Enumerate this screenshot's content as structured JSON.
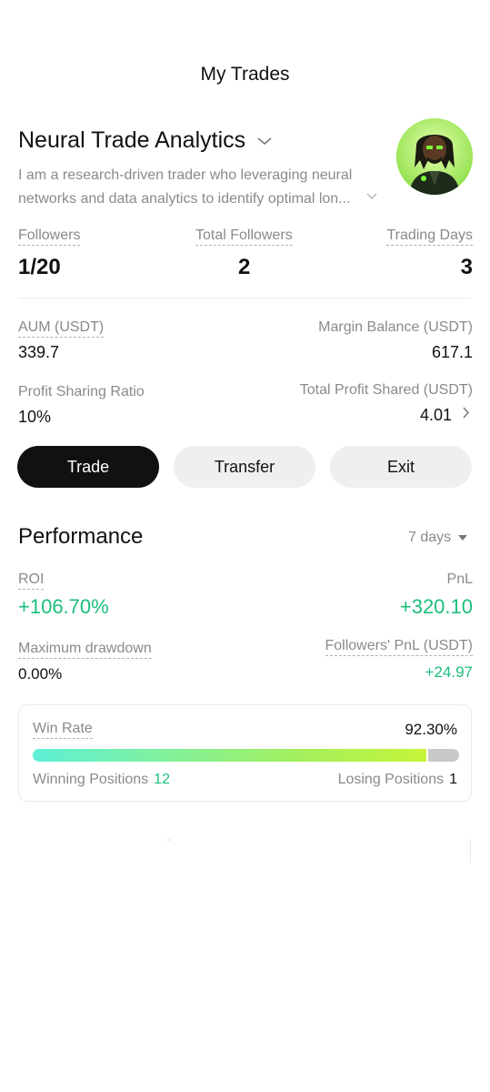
{
  "header": {
    "title": "My Trades"
  },
  "profile": {
    "name": "Neural Trade Analytics",
    "bio_line1": "I am a research-driven trader who leveraging neural",
    "bio_line2": "networks and data analytics to identify optimal lon..."
  },
  "stats": {
    "followers_label": "Followers",
    "followers_value": "1/20",
    "total_followers_label": "Total Followers",
    "total_followers_value": "2",
    "trading_days_label": "Trading Days",
    "trading_days_value": "3"
  },
  "account": {
    "aum_label": "AUM (USDT)",
    "aum_value": "339.7",
    "margin_label": "Margin Balance (USDT)",
    "margin_value": "617.1",
    "profit_ratio_label": "Profit Sharing Ratio",
    "profit_ratio_value": "10%",
    "total_profit_label": "Total Profit Shared (USDT)",
    "total_profit_value": "4.01"
  },
  "actions": {
    "trade": "Trade",
    "transfer": "Transfer",
    "exit": "Exit"
  },
  "performance": {
    "title": "Performance",
    "period": "7 days",
    "roi_label": "ROI",
    "roi_value": "+106.70%",
    "pnl_label": "PnL",
    "pnl_value": "+320.10",
    "drawdown_label": "Maximum drawdown",
    "drawdown_value": "0.00%",
    "followers_pnl_label": "Followers' PnL (USDT)",
    "followers_pnl_value": "+24.97"
  },
  "win_rate": {
    "label": "Win Rate",
    "value": "92.30%",
    "fraction": 0.923,
    "winning_label": "Winning Positions",
    "winning_count": "12",
    "losing_label": "Losing Positions",
    "losing_count": "1"
  },
  "colors": {
    "accent_green": "#1bbf7a",
    "button_dark": "#111111",
    "button_light": "#efefef"
  },
  "icons": {
    "name_dropdown": "chevron-down-icon",
    "bio_expand": "chevron-down-icon",
    "profit_detail": "chevron-right-icon",
    "period_dropdown": "caret-down-icon"
  }
}
